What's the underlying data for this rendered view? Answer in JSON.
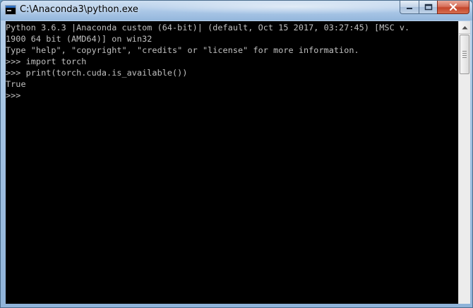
{
  "window": {
    "title": "C:\\Anaconda3\\python.exe"
  },
  "console": {
    "lines": [
      "Python 3.6.3 |Anaconda custom (64-bit)| (default, Oct 15 2017, 03:27:45) [MSC v.",
      "1900 64 bit (AMD64)] on win32",
      "Type \"help\", \"copyright\", \"credits\" or \"license\" for more information.",
      ">>> import torch",
      ">>> print(torch.cuda.is_available())",
      "True",
      ">>>"
    ]
  },
  "icons": {
    "app": "console-app-icon",
    "minimize": "minimize-icon",
    "maximize": "maximize-icon",
    "close": "close-icon",
    "scroll_up": "arrow-up-icon"
  },
  "colors": {
    "console_bg": "#000000",
    "console_fg": "#c0c0c0",
    "close_button": "#c4452b"
  }
}
